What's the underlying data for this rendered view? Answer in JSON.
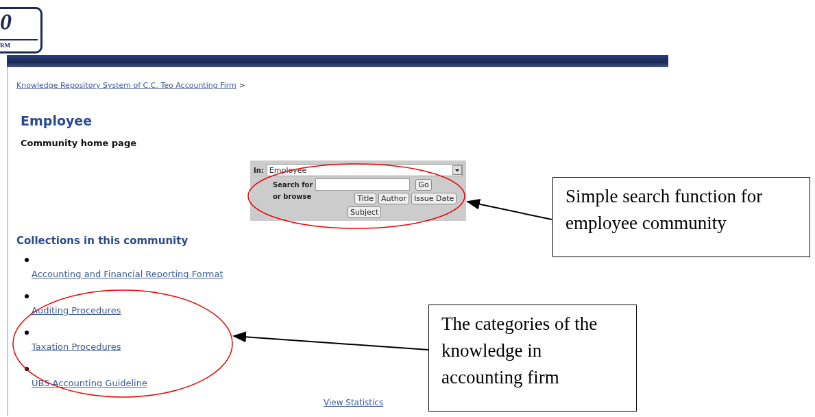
{
  "logo": {
    "mark": "0",
    "caption": "RM"
  },
  "breadcrumb": {
    "link": "Knowledge Repository System of C.C. Teo Accounting Firm",
    "separator": ">"
  },
  "heading": "Employee",
  "subheading": "Community home page",
  "search": {
    "scope_label": "In:",
    "scope_value": "Employee",
    "search_label": "Search for",
    "go": "Go",
    "browse_prefix": "or",
    "browse_label": "browse",
    "browse_buttons": [
      "Title",
      "Author",
      "Issue Date",
      "Subject"
    ]
  },
  "collections": {
    "title": "Collections in this community",
    "items": [
      "Accounting and Financial Reporting Format",
      "Auditing Procedures",
      "Taxation Procedures",
      "UBS Accounting Guideline"
    ]
  },
  "view_statistics": "View Statistics",
  "annotations": [
    {
      "text": "Simple search function for employee community"
    },
    {
      "text": "The categories of the knowledge in accounting firm"
    }
  ]
}
